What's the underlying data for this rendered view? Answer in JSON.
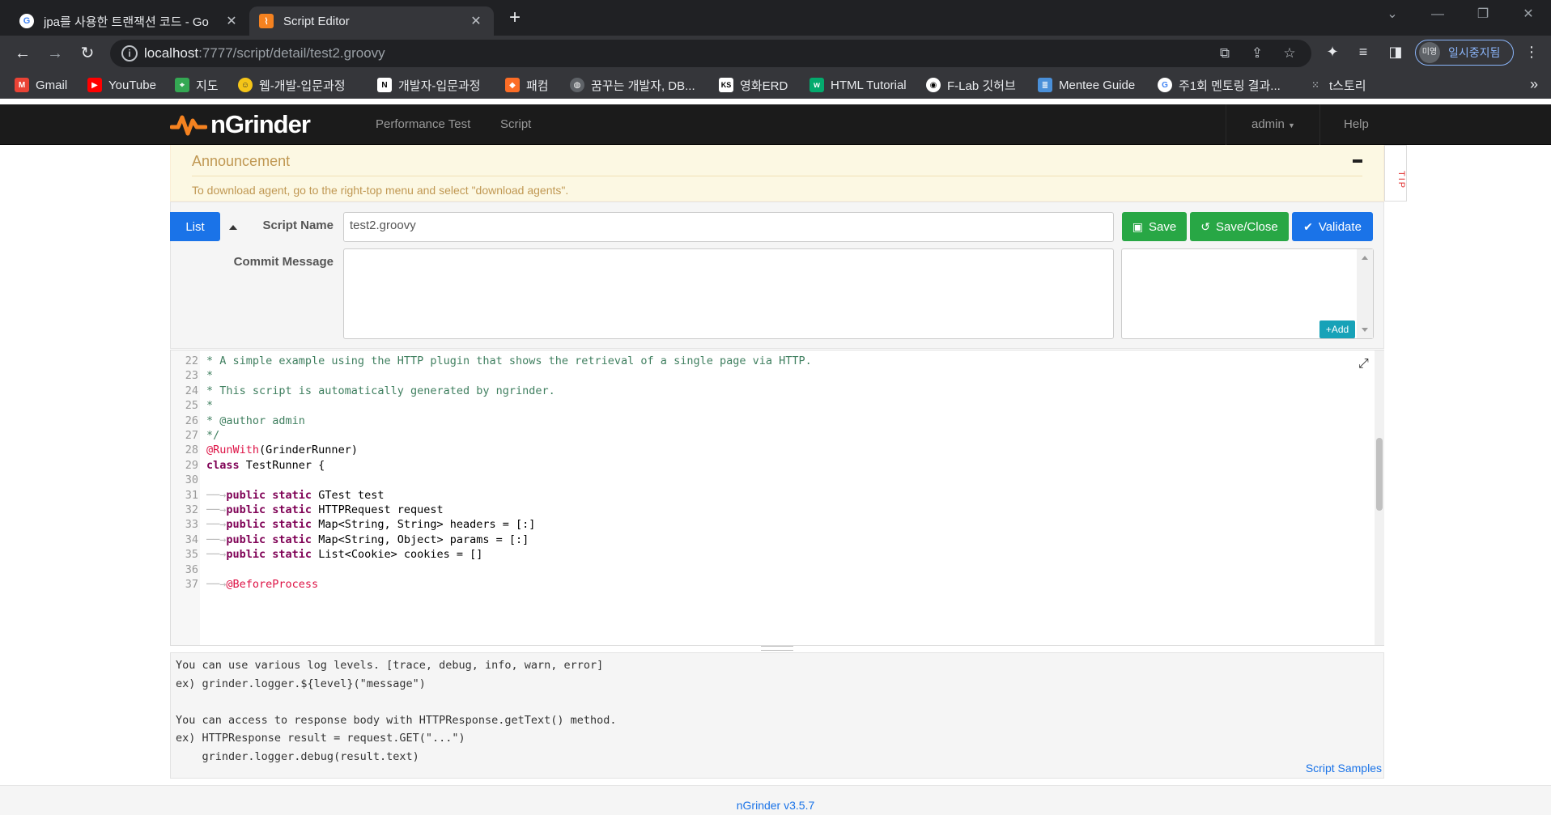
{
  "browser": {
    "tabs": [
      {
        "title": "jpa를 사용한 트랜잭션 코드 - Go",
        "favicon": "google-icon",
        "active": false
      },
      {
        "title": "Script Editor",
        "favicon": "ngrinder-icon",
        "active": true
      }
    ],
    "url_host": "localhost",
    "url_path": ":7777/script/detail/test2.groovy",
    "profile_avatar": "미영",
    "profile_label": "일시중지됨",
    "bookmarks": [
      {
        "label": "Gmail",
        "icon": "gmail-icon",
        "color": "#ea4335"
      },
      {
        "label": "YouTube",
        "icon": "youtube-icon",
        "color": "#ff0000"
      },
      {
        "label": "지도",
        "icon": "maps-icon",
        "color": "#34a853"
      },
      {
        "label": "웹-개발-입문과정",
        "icon": "smiley-icon",
        "color": "#f5c518"
      },
      {
        "label": "개발자-입문과정",
        "icon": "notion-icon",
        "color": "#ffffff"
      },
      {
        "label": "패컴",
        "icon": "gitlab-icon",
        "color": "#fc6d26"
      },
      {
        "label": "꿈꾸는 개발자, DB...",
        "icon": "globe-icon",
        "color": "#9aa0a6"
      },
      {
        "label": "영화ERD",
        "icon": "ks-icon",
        "color": "#ffffff"
      },
      {
        "label": "HTML Tutorial",
        "icon": "w3-icon",
        "color": "#04aa6d"
      },
      {
        "label": "F-Lab 깃허브",
        "icon": "github-icon",
        "color": "#ffffff"
      },
      {
        "label": "Mentee Guide",
        "icon": "doc-icon",
        "color": "#4a90d9"
      },
      {
        "label": "주1회 멘토링 결과...",
        "icon": "google-icon",
        "color": "#4285f4"
      },
      {
        "label": "t스토리",
        "icon": "tistory-icon",
        "color": "#9aa0a6"
      }
    ]
  },
  "nav": {
    "brand": "nGrinder",
    "links": [
      "Performance Test",
      "Script"
    ],
    "user": "admin",
    "help": "Help"
  },
  "announcement": {
    "title": "Announcement",
    "text": "To download agent, go to the right-top menu and select \"download agents\".",
    "tip": "TIP"
  },
  "form": {
    "list_label": "List",
    "script_name_label": "Script Name",
    "script_name_value": "test2.groovy",
    "commit_label": "Commit Message",
    "commit_value": "",
    "save_label": "Save",
    "save_close_label": "Save/Close",
    "validate_label": "Validate",
    "add_label": "Add"
  },
  "editor": {
    "lines": [
      {
        "n": "22",
        "parts": [
          {
            "t": "* A simple example using the HTTP plugin that shows the retrieval of a single page via HTTP.",
            "c": "cm"
          }
        ]
      },
      {
        "n": "23",
        "parts": [
          {
            "t": "*",
            "c": "cm"
          }
        ]
      },
      {
        "n": "24",
        "parts": [
          {
            "t": "* This script is automatically generated by ngrinder.",
            "c": "cm"
          }
        ]
      },
      {
        "n": "25",
        "parts": [
          {
            "t": "*",
            "c": "cm"
          }
        ]
      },
      {
        "n": "26",
        "parts": [
          {
            "t": "* @author admin",
            "c": "cm"
          }
        ]
      },
      {
        "n": "27",
        "parts": [
          {
            "t": "*/",
            "c": "cm"
          }
        ]
      },
      {
        "n": "28",
        "parts": [
          {
            "t": "@RunWith",
            "c": "an"
          },
          {
            "t": "(GrinderRunner)",
            "c": ""
          }
        ]
      },
      {
        "n": "29",
        "parts": [
          {
            "t": "class",
            "c": "kw"
          },
          {
            "t": " TestRunner {",
            "c": ""
          }
        ]
      },
      {
        "n": "30",
        "parts": []
      },
      {
        "n": "31",
        "parts": [
          {
            "t": "──→",
            "c": "tabmark"
          },
          {
            "t": "public static",
            "c": "kw"
          },
          {
            "t": " GTest test",
            "c": ""
          }
        ]
      },
      {
        "n": "32",
        "parts": [
          {
            "t": "──→",
            "c": "tabmark"
          },
          {
            "t": "public static",
            "c": "kw"
          },
          {
            "t": " HTTPRequest request",
            "c": ""
          }
        ]
      },
      {
        "n": "33",
        "parts": [
          {
            "t": "──→",
            "c": "tabmark"
          },
          {
            "t": "public static",
            "c": "kw"
          },
          {
            "t": " Map<String, String> headers = [:]",
            "c": ""
          }
        ]
      },
      {
        "n": "34",
        "parts": [
          {
            "t": "──→",
            "c": "tabmark"
          },
          {
            "t": "public static",
            "c": "kw"
          },
          {
            "t": " Map<String, Object> params = [:]",
            "c": ""
          }
        ]
      },
      {
        "n": "35",
        "parts": [
          {
            "t": "──→",
            "c": "tabmark"
          },
          {
            "t": "public static",
            "c": "kw"
          },
          {
            "t": " List<Cookie> cookies = []",
            "c": ""
          }
        ]
      },
      {
        "n": "36",
        "parts": []
      },
      {
        "n": "37",
        "parts": [
          {
            "t": "──→",
            "c": "tabmark"
          },
          {
            "t": "@BeforeProcess",
            "c": "an"
          }
        ]
      }
    ]
  },
  "help": {
    "lines": [
      "You can use various log levels. [trace, debug, info, warn, error]",
      "ex) grinder.logger.${level}(\"message\")",
      "",
      "You can access to response body with HTTPResponse.getText() method.",
      "ex) HTTPResponse result = request.GET(\"...\")",
      "    grinder.logger.debug(result.text)"
    ],
    "samples_link": "Script Samples"
  },
  "footer": {
    "version": "nGrinder v3.5.7"
  }
}
